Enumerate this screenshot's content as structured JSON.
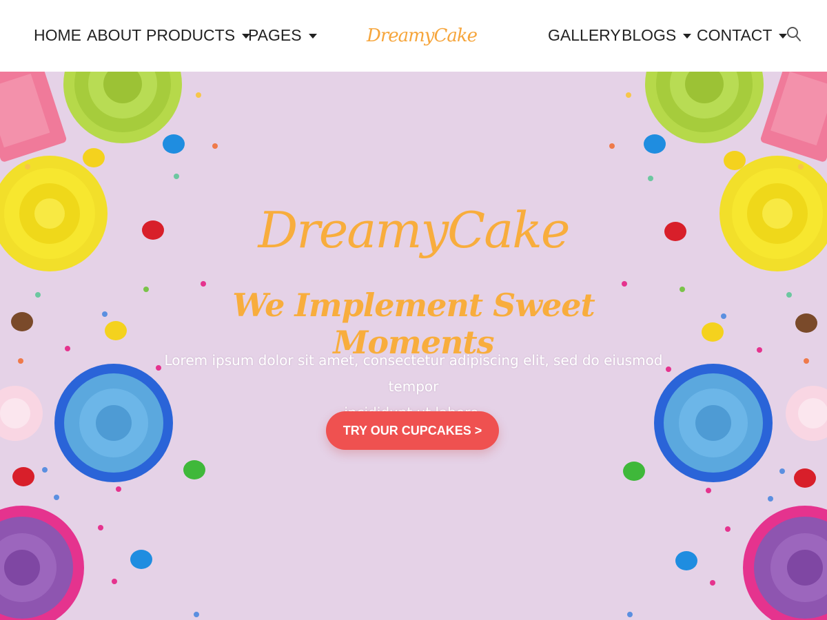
{
  "nav": {
    "left_items": [
      {
        "label": "HOME",
        "has_dropdown": false
      },
      {
        "label": "ABOUT",
        "has_dropdown": false
      },
      {
        "label": "PRODUCTS",
        "has_dropdown": true
      },
      {
        "label": "PAGES",
        "has_dropdown": true
      }
    ],
    "logo_text": "DreamyCake",
    "right_items": [
      {
        "label": "GALLERY",
        "has_dropdown": false
      },
      {
        "label": "BLOGS",
        "has_dropdown": true
      },
      {
        "label": "CONTACT",
        "has_dropdown": true
      }
    ],
    "search_icon": "search-icon"
  },
  "hero": {
    "title": "DreamyCake",
    "subtitle": "We Implement Sweet Moments",
    "text_line1": "Lorem ipsum dolor sit amet, consectetur adipiscing elit, sed do eiusmod tempor",
    "text_line2": "incididunt ut labore.",
    "cta_label": "TRY OUR CUPCAKES >"
  },
  "colors": {
    "accent_orange": "#f8ad3d",
    "cta_red": "#ef5150",
    "hero_background": "#e5d2e7",
    "nav_text": "#222222"
  }
}
